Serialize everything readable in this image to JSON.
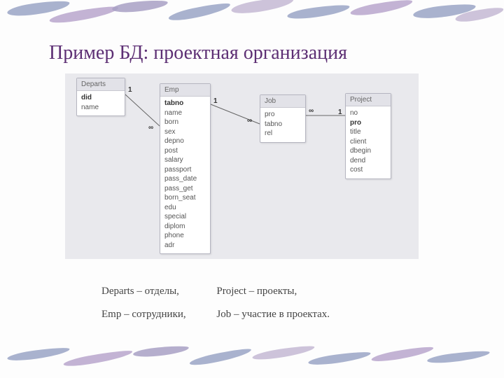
{
  "title": "Пример БД: проектная организация",
  "entities": {
    "departs": {
      "name": "Departs",
      "fields": [
        "did",
        "name"
      ],
      "pk": [
        "did"
      ]
    },
    "emp": {
      "name": "Emp",
      "fields": [
        "tabno",
        "name",
        "born",
        "sex",
        "depno",
        "post",
        "salary",
        "passport",
        "pass_date",
        "pass_get",
        "born_seat",
        "edu",
        "special",
        "diplom",
        "phone",
        "adr"
      ],
      "pk": [
        "tabno"
      ]
    },
    "job": {
      "name": "Job",
      "fields": [
        "pro",
        "tabno",
        "rel"
      ],
      "pk": []
    },
    "project": {
      "name": "Project",
      "fields": [
        "no",
        "pro",
        "title",
        "client",
        "dbegin",
        "dend",
        "cost"
      ],
      "pk": [
        "pro"
      ]
    }
  },
  "relations": {
    "r1_left": "1",
    "r1_right": "∞",
    "r2_left": "1",
    "r2_right": "∞",
    "r3_left": "∞",
    "r3_right": "1"
  },
  "legend": {
    "departs": "Departs – отделы,",
    "emp": "Emp – сотрудники,",
    "project": "Project – проекты,",
    "job": "Job – участие в проектах."
  },
  "colors": {
    "brush1": "#9aa4c6",
    "brush2": "#b59dc2",
    "brush3": "#c4b8d4"
  }
}
